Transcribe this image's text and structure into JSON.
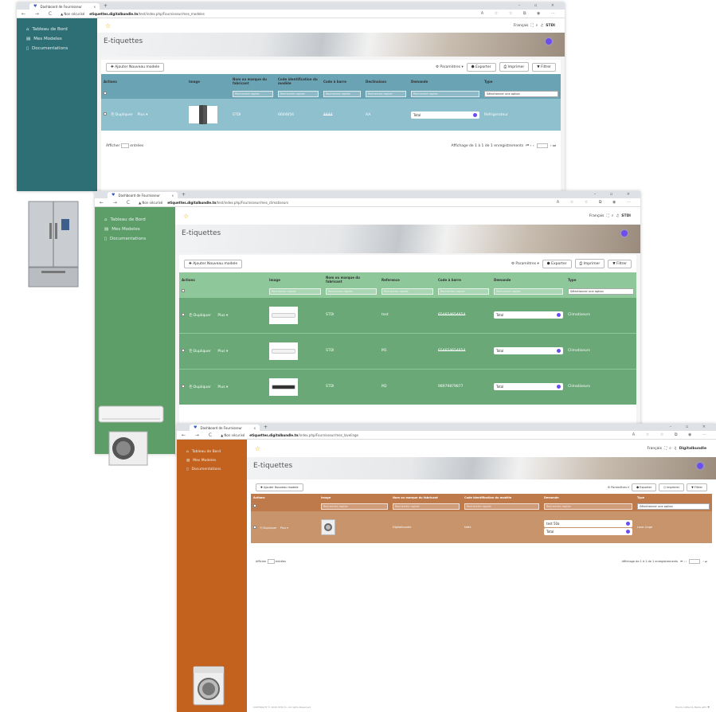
{
  "browser": {
    "tab_title": "Dashboard de Fournisseur",
    "tab_close": "x",
    "new_tab": "+",
    "window_controls": "– ▫ ×",
    "nav": "← → C",
    "security": "▲ Non sécurisé",
    "host": "etiquettes.digitalbundle.tn",
    "tools": "A ☆ ☆ ⧉ ◉ ⋯"
  },
  "windows": [
    {
      "path": "/test/index.php/Fournisseur/mes_modeles",
      "theme": "#2e6e75"
    },
    {
      "path": "/test/index.php/Fournisseur/mes_climatiseurs",
      "theme": "#5d9e68"
    },
    {
      "path": "/index.php/Fournisseur/mes_lavelinge",
      "theme": "#c3611e"
    }
  ],
  "sidebar": {
    "items": [
      "Tableau de Bord",
      "Mes Modeles",
      "Documentations"
    ]
  },
  "header": {
    "lang": "Français",
    "user1": "STDI",
    "user2": "Digitalbundle",
    "fullscreen": "⛶",
    "search": "⌕",
    "bell": "♫"
  },
  "page_title": "E-tiquettes",
  "toolbar": {
    "add": "✚ Ajouter Nouveau modele",
    "params": "⚙ Paramètres ▾",
    "export": "⬢ Exporter",
    "print": "⎙ Imprimer",
    "filter": "▼ Filtrer"
  },
  "placeholder": "Recherche rapide",
  "select_option": "Sélectionner une option",
  "row_actions": {
    "duplicate": "⎘ Dupliquer",
    "more": "Plus ▾"
  },
  "table1": {
    "headers": [
      "Actions",
      "Image",
      "Nom ou marque du fabricant",
      "Code identification du modèle",
      "Code à barre",
      "Declinaison",
      "Demande",
      "Type"
    ],
    "rows": [
      {
        "fabricant": "STDI",
        "code": "6604654",
        "barcode": "4444",
        "decl": "AA",
        "demande": [
          "Total"
        ],
        "type": "Refrigerateur"
      }
    ]
  },
  "table2": {
    "headers": [
      "Actions",
      "Image",
      "Nom ou marque du fabricant",
      "Reference",
      "Code à barre",
      "Demande",
      "Type"
    ],
    "rows": [
      {
        "fabricant": "STDI",
        "ref": "test",
        "barcode": "654654654654",
        "demande": [
          "Total"
        ],
        "type": "Climatiseurs"
      },
      {
        "fabricant": "STDI",
        "ref": "M1",
        "barcode": "654654654654",
        "demande": [
          "Total"
        ],
        "type": "Climatiseurs"
      },
      {
        "fabricant": "STDI",
        "ref": "M2",
        "barcode": "98979879877",
        "demande": [
          "Total"
        ],
        "type": "Climatiseurs"
      }
    ]
  },
  "table3": {
    "headers": [
      "Actions",
      "Image",
      "Nom ou marque du fabricant",
      "Code identification du modèle",
      "Demande",
      "Type"
    ],
    "rows": [
      {
        "fabricant": "Digitalbundle",
        "code": "fzdfz",
        "demande": [
          "test 50a",
          "Total"
        ],
        "type": "Lave-Linge"
      }
    ]
  },
  "footer": {
    "show": "Afficher",
    "entries": "entrées",
    "info": "Affichage de 1 à 1 de 1 enregistrements",
    "pager": "⏮ ‹ ‹",
    "pager_next": "› ⏭"
  },
  "copyright": "COPYRIGHT © 2020 STDI tn, All rights Reserved",
  "credit": "Hand-crafted & Made with ♥"
}
